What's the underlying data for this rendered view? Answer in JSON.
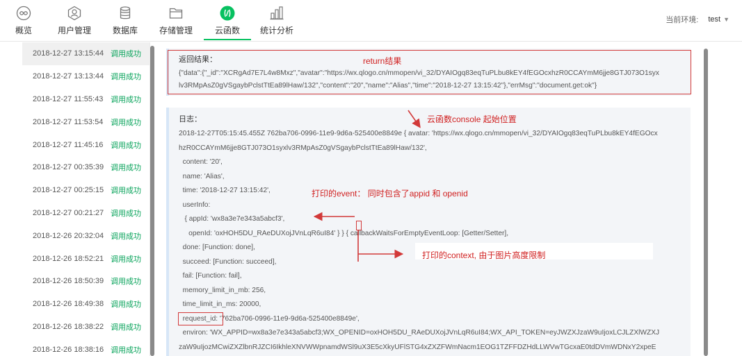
{
  "toolbar": {
    "items": [
      {
        "label": "概览",
        "icon": "overview-icon"
      },
      {
        "label": "用户管理",
        "icon": "user-management-icon"
      },
      {
        "label": "数据库",
        "icon": "database-icon"
      },
      {
        "label": "存储管理",
        "icon": "storage-folder-icon"
      },
      {
        "label": "云函数",
        "icon": "cloud-function-icon"
      },
      {
        "label": "统计分析",
        "icon": "statistics-icon"
      }
    ],
    "active_index": 4,
    "accent_color": "#07c160",
    "env_label": "当前环境:",
    "env_value": "test"
  },
  "logs": [
    {
      "time": "2018-12-27 13:15:44",
      "status": "调用成功"
    },
    {
      "time": "2018-12-27 13:13:44",
      "status": "调用成功"
    },
    {
      "time": "2018-12-27 11:55:43",
      "status": "调用成功"
    },
    {
      "time": "2018-12-27 11:53:54",
      "status": "调用成功"
    },
    {
      "time": "2018-12-27 11:45:16",
      "status": "调用成功"
    },
    {
      "time": "2018-12-27 00:35:39",
      "status": "调用成功"
    },
    {
      "time": "2018-12-27 00:25:15",
      "status": "调用成功"
    },
    {
      "time": "2018-12-27 00:21:27",
      "status": "调用成功"
    },
    {
      "time": "2018-12-26 20:32:04",
      "status": "调用成功"
    },
    {
      "time": "2018-12-26 18:52:21",
      "status": "调用成功"
    },
    {
      "time": "2018-12-26 18:50:39",
      "status": "调用成功"
    },
    {
      "time": "2018-12-26 18:49:38",
      "status": "调用成功"
    },
    {
      "time": "2018-12-26 18:38:22",
      "status": "调用成功"
    },
    {
      "time": "2018-12-26 18:38:16",
      "status": "调用成功"
    }
  ],
  "result": {
    "title": "返回结果：",
    "line1": "{\"data\":{\"_id\":\"XCRgAd7E7L4w8Mxz\",\"avatar\":\"https://wx.qlogo.cn/mmopen/vi_32/DYAIOgq83eqTuPLbu8kEY4fEGOcxhzR0CCAYmM6jje8GTJ073O1syx",
    "line2": "lv3RMpAsZ0gVSgaybPclstTtEa89lHaw/132\",\"content\":\"20\",\"name\":\"Alias\",\"time\":\"2018-12-27 13:15:42\"},\"errMsg\":\"document.get:ok\"}"
  },
  "log": {
    "title": "日志：",
    "lines": [
      "2018-12-27T05:15:45.455Z 762ba706-0996-11e9-9d6a-525400e8849e { avatar: 'https://wx.qlogo.cn/mmopen/vi_32/DYAIOgq83eqTuPLbu8kEY4fEGOcx",
      "hzR0CCAYmM6jje8GTJ073O1syxlv3RMpAsZ0gVSgaybPclstTtEa89lHaw/132',",
      "  content: '20',",
      "  name: 'Alias',",
      "  time: '2018-12-27 13:15:42',",
      "  userInfo:",
      "   { appId: 'wx8a3e7e343a5abcf3',",
      "     openId: 'oxHOH5DU_RAeDUXojJVnLqR6uI84' } } { callbackWaitsForEmptyEventLoop: [Getter/Setter],",
      "  done: [Function: done],",
      "  succeed: [Function: succeed],",
      "  fail: [Function: fail],",
      "  memory_limit_in_mb: 256,",
      "  time_limit_in_ms: 20000,",
      "  request_id: '762ba706-0996-11e9-9d6a-525400e8849e',",
      "  environ: 'WX_APPID=wx8a3e7e343a5abcf3;WX_OPENID=oxHOH5DU_RAeDUXojJVnLqR6uI84;WX_API_TOKEN=eyJWZXJzaW9uIjoxLCJLZXlWZXJ",
      "zaW9uIjozMCwiZXZlbnRJZCI6IkhleXNVWWpnamdWSl9uX3E5cXkyUFlSTG4xZXZFWmNacm1EOG1TZFFDZHdLLWVwTGcxaE0tdDVmWDNxY2xpeE"
    ]
  },
  "annotations": {
    "return": "return结果",
    "console_start": "云函数console 起始位置",
    "event": "打印的event： 同时包含了appid 和 openid",
    "context": "打印的context, 由于图片高度限制",
    "color": "#d02020"
  }
}
